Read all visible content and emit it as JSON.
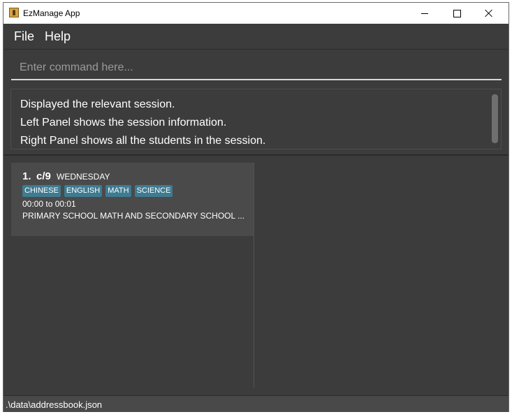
{
  "window": {
    "title": "EzManage App"
  },
  "menu": {
    "file": "File",
    "help": "Help"
  },
  "command": {
    "placeholder": "Enter command here...",
    "value": ""
  },
  "result": {
    "lines": [
      "Displayed the relevant session.",
      "Left Panel shows the session information.",
      "Right Panel shows all the students in the session."
    ]
  },
  "session_list": [
    {
      "index": "1.",
      "name": "c/9",
      "day": "WEDNESDAY",
      "tags": [
        "CHINESE",
        "ENGLISH",
        "MATH",
        "SCIENCE"
      ],
      "time": "00:00 to 00:01",
      "description": "PRIMARY SCHOOL MATH AND SECONDARY SCHOOL ..."
    }
  ],
  "status": {
    "path": ".\\data\\addressbook.json"
  },
  "colors": {
    "background": "#3c3c3c",
    "card": "#4a4a4a",
    "tag": "#3e7b91",
    "text": "#ffffff"
  }
}
